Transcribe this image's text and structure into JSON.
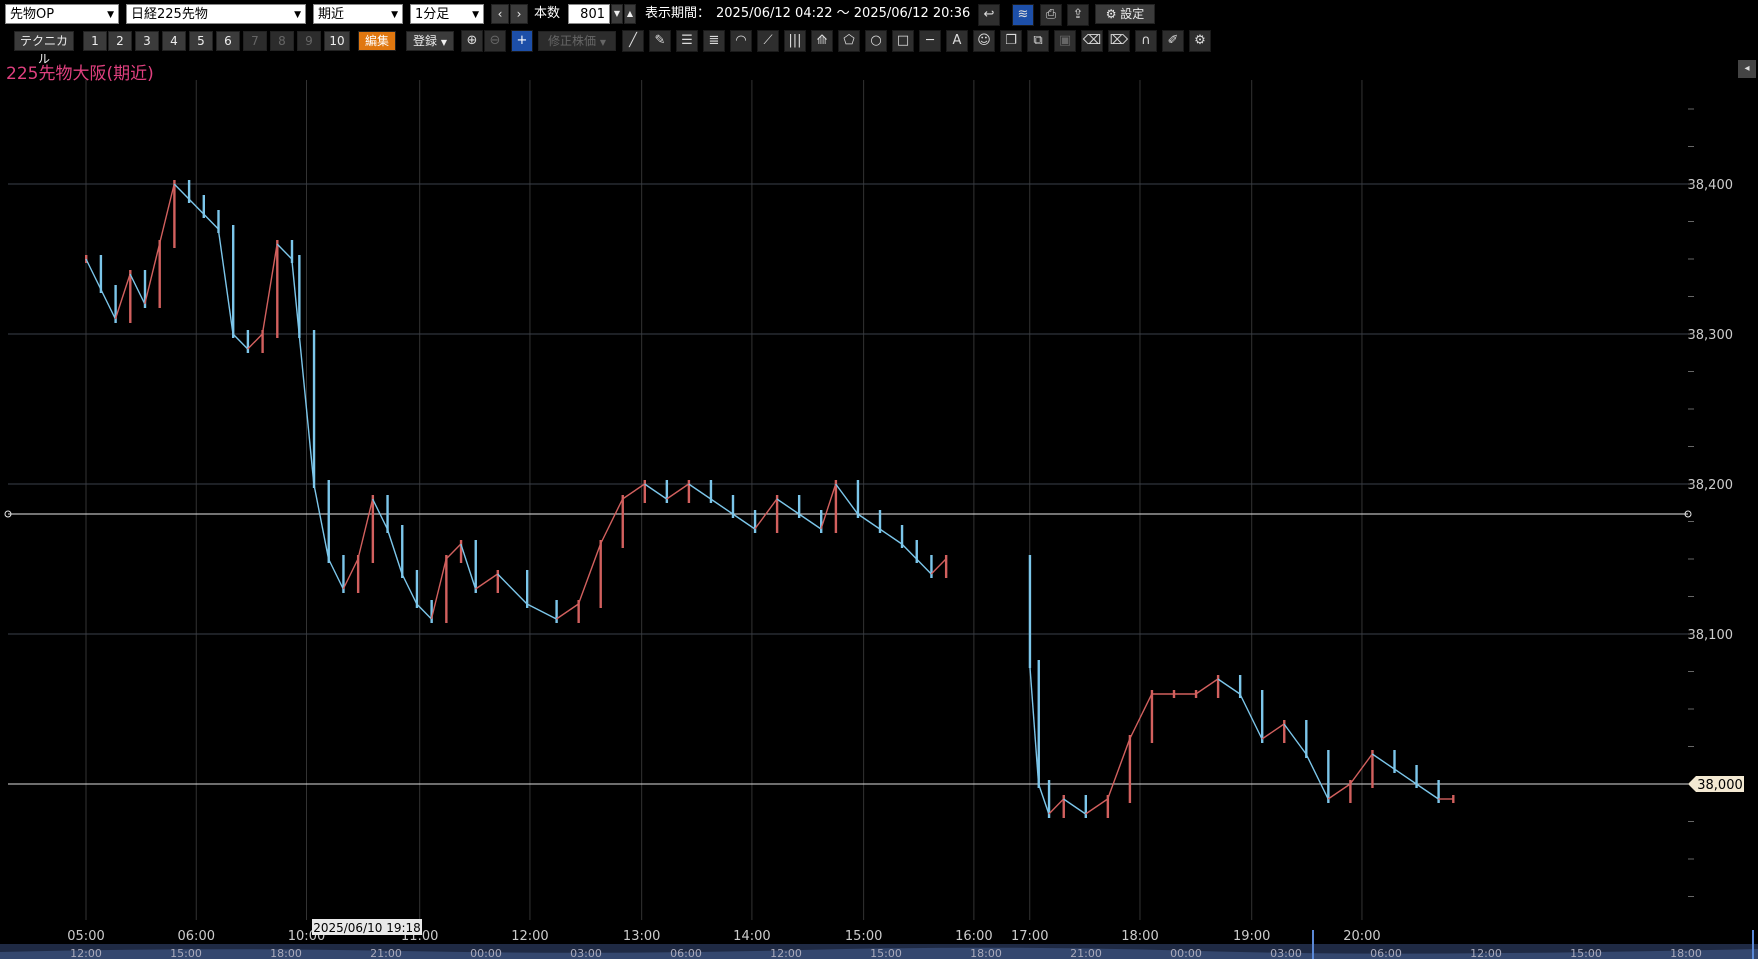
{
  "toolbar": {
    "product_select": "先物OP",
    "instrument_select": "日経225先物",
    "contract_select": "期近",
    "interval_select": "1分足",
    "count_label": "本数",
    "count_value": "801",
    "period_label": "表示期間：",
    "period_value": "2025/06/12 04:22 ～ 2025/06/12 20:36",
    "settings_label": "設定"
  },
  "toolbar2": {
    "technical_label": "テクニカル",
    "presets": [
      "1",
      "2",
      "3",
      "4",
      "5",
      "6",
      "7",
      "8",
      "9",
      "10"
    ],
    "edit_label": "編集",
    "register_label": "登録",
    "adjusted_price_label": "修正株価"
  },
  "chart_title": "225先物大阪(期近)",
  "colors": {
    "up": "#d2605e",
    "down": "#7cc6ea",
    "title": "#e0407f",
    "grid": "#333333"
  },
  "chart_data": {
    "type": "candlestick",
    "title": "225先物大阪(期近)",
    "ylim": [
      37950,
      38450
    ],
    "yticks": [
      38100,
      38200,
      38300,
      38400
    ],
    "ytick_labels": [
      "38,100",
      "38,200",
      "38,300",
      "38,400"
    ],
    "price_marker": {
      "value": 38000,
      "label": "38,000"
    },
    "hline": 38180,
    "xticks_time": [
      {
        "label": "05:00",
        "pos": 0.0
      },
      {
        "label": "06:00",
        "pos": 0.075
      },
      {
        "label": "10:00",
        "pos": 0.15
      },
      {
        "label": "11:00",
        "pos": 0.227
      },
      {
        "label": "12:00",
        "pos": 0.302
      },
      {
        "label": "13:00",
        "pos": 0.378
      },
      {
        "label": "14:00",
        "pos": 0.453
      },
      {
        "label": "15:00",
        "pos": 0.529
      },
      {
        "label": "16:00",
        "pos": 0.604
      },
      {
        "label": "17:00",
        "pos": 0.642
      },
      {
        "label": "18:00",
        "pos": 0.717
      },
      {
        "label": "19:00",
        "pos": 0.793
      },
      {
        "label": "20:00",
        "pos": 0.868
      }
    ],
    "navigator_ticks": [
      "12:00",
      "15:00",
      "18:00",
      "21:00",
      "00:00",
      "03:00",
      "06:00",
      "12:00",
      "15:00",
      "18:00",
      "21:00",
      "00:00",
      "03:00",
      "06:00",
      "12:00",
      "15:00",
      "18:00"
    ],
    "navigator_label": "2025/06/10 19:18",
    "series": [
      {
        "pos": 0.0,
        "v": 38350
      },
      {
        "pos": 0.01,
        "v": 38330
      },
      {
        "pos": 0.02,
        "v": 38310
      },
      {
        "pos": 0.03,
        "v": 38340
      },
      {
        "pos": 0.04,
        "v": 38320
      },
      {
        "pos": 0.05,
        "v": 38360
      },
      {
        "pos": 0.06,
        "v": 38400
      },
      {
        "pos": 0.07,
        "v": 38390
      },
      {
        "pos": 0.08,
        "v": 38380
      },
      {
        "pos": 0.09,
        "v": 38370
      },
      {
        "pos": 0.1,
        "v": 38300
      },
      {
        "pos": 0.11,
        "v": 38290
      },
      {
        "pos": 0.12,
        "v": 38300
      },
      {
        "pos": 0.13,
        "v": 38360
      },
      {
        "pos": 0.14,
        "v": 38350
      },
      {
        "pos": 0.145,
        "v": 38300
      },
      {
        "pos": 0.155,
        "v": 38200
      },
      {
        "pos": 0.165,
        "v": 38150
      },
      {
        "pos": 0.175,
        "v": 38130
      },
      {
        "pos": 0.185,
        "v": 38150
      },
      {
        "pos": 0.195,
        "v": 38190
      },
      {
        "pos": 0.205,
        "v": 38170
      },
      {
        "pos": 0.215,
        "v": 38140
      },
      {
        "pos": 0.225,
        "v": 38120
      },
      {
        "pos": 0.235,
        "v": 38110
      },
      {
        "pos": 0.245,
        "v": 38150
      },
      {
        "pos": 0.255,
        "v": 38160
      },
      {
        "pos": 0.265,
        "v": 38130
      },
      {
        "pos": 0.28,
        "v": 38140
      },
      {
        "pos": 0.3,
        "v": 38120
      },
      {
        "pos": 0.32,
        "v": 38110
      },
      {
        "pos": 0.335,
        "v": 38120
      },
      {
        "pos": 0.35,
        "v": 38160
      },
      {
        "pos": 0.365,
        "v": 38190
      },
      {
        "pos": 0.38,
        "v": 38200
      },
      {
        "pos": 0.395,
        "v": 38190
      },
      {
        "pos": 0.41,
        "v": 38200
      },
      {
        "pos": 0.425,
        "v": 38190
      },
      {
        "pos": 0.44,
        "v": 38180
      },
      {
        "pos": 0.455,
        "v": 38170
      },
      {
        "pos": 0.47,
        "v": 38190
      },
      {
        "pos": 0.485,
        "v": 38180
      },
      {
        "pos": 0.5,
        "v": 38170
      },
      {
        "pos": 0.51,
        "v": 38200
      },
      {
        "pos": 0.525,
        "v": 38180
      },
      {
        "pos": 0.54,
        "v": 38170
      },
      {
        "pos": 0.555,
        "v": 38160
      },
      {
        "pos": 0.565,
        "v": 38150
      },
      {
        "pos": 0.575,
        "v": 38140
      },
      {
        "pos": 0.585,
        "v": 38150
      },
      {
        "pos": 0.642,
        "v": 38080
      },
      {
        "pos": 0.648,
        "v": 38000
      },
      {
        "pos": 0.655,
        "v": 37980
      },
      {
        "pos": 0.665,
        "v": 37990
      },
      {
        "pos": 0.68,
        "v": 37980
      },
      {
        "pos": 0.695,
        "v": 37990
      },
      {
        "pos": 0.71,
        "v": 38030
      },
      {
        "pos": 0.725,
        "v": 38060
      },
      {
        "pos": 0.74,
        "v": 38060
      },
      {
        "pos": 0.755,
        "v": 38060
      },
      {
        "pos": 0.77,
        "v": 38070
      },
      {
        "pos": 0.785,
        "v": 38060
      },
      {
        "pos": 0.8,
        "v": 38030
      },
      {
        "pos": 0.815,
        "v": 38040
      },
      {
        "pos": 0.83,
        "v": 38020
      },
      {
        "pos": 0.845,
        "v": 37990
      },
      {
        "pos": 0.86,
        "v": 38000
      },
      {
        "pos": 0.875,
        "v": 38020
      },
      {
        "pos": 0.89,
        "v": 38010
      },
      {
        "pos": 0.905,
        "v": 38000
      },
      {
        "pos": 0.92,
        "v": 37990
      },
      {
        "pos": 0.93,
        "v": 37990
      }
    ]
  }
}
